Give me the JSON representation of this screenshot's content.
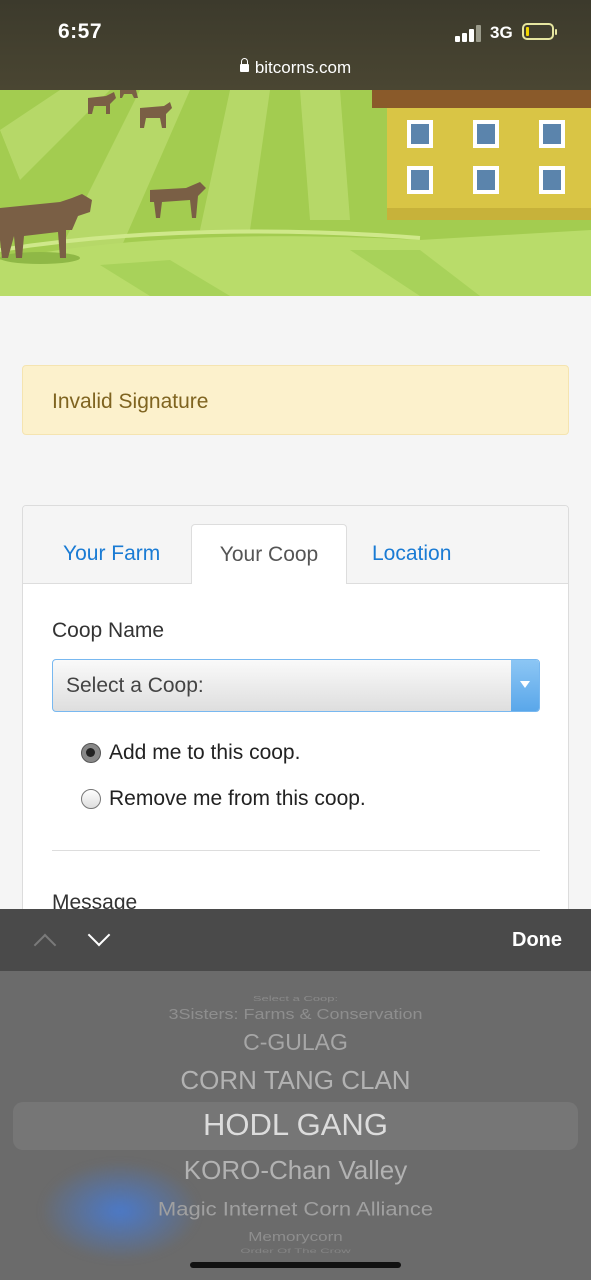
{
  "status_bar": {
    "time": "6:57",
    "network": "3G"
  },
  "browser": {
    "url": "bitcorns.com"
  },
  "alert": {
    "text": "Invalid Signature"
  },
  "tabs": [
    {
      "label": "Your Farm"
    },
    {
      "label": "Your Coop"
    },
    {
      "label": "Location"
    }
  ],
  "form": {
    "coop_name_label": "Coop Name",
    "select_value": "Select a Coop:",
    "radio_add": "Add me to this coop.",
    "radio_remove": "Remove me from this coop.",
    "message_label": "Message"
  },
  "accessory": {
    "done_label": "Done"
  },
  "picker": {
    "items": [
      "Select a Coop:",
      "3Sisters: Farms & Conservation",
      "C-GULAG",
      "CORN TANG CLAN",
      "HODL GANG",
      "KORO-Chan Valley",
      "Magic Internet Corn Alliance",
      "Memorycorn",
      "Order Of The Crow"
    ],
    "selected": "HODL GANG"
  },
  "colors": {
    "link": "#1a7bd4",
    "alert_bg": "#fcf1cc",
    "alert_text": "#7f6420"
  }
}
